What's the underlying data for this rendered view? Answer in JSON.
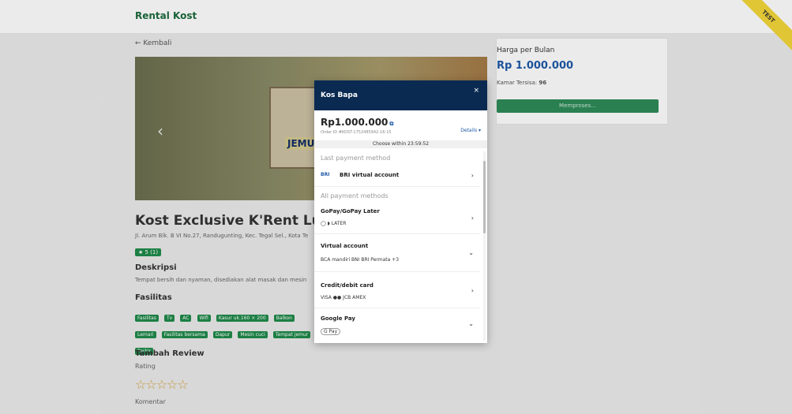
{
  "app": {
    "brand": "Rental Kost",
    "ribbon": "TEST"
  },
  "nav": {
    "back": "← Kembali"
  },
  "hero": {
    "poster_text": "JEMURAN PR",
    "prev_icon": "chevron-left"
  },
  "listing": {
    "title": "Kost Exclusive K'Rent Luxury T",
    "address": "Jl. Arum Blk. B VI No.27, Randugunting, Kec. Tegal Sel., Kota Te",
    "rating": "★ 5 (1)",
    "description_heading": "Deskripsi",
    "description": "Tempat bersih dan nyaman, disediakan alat masak dan mesin",
    "facilities_heading": "Fasilitas",
    "facilities": [
      "Fasilitas",
      "Tv",
      "AC",
      "Wifi",
      "Kasur uk.160 × 200",
      "Balkon",
      "Lemari",
      "Fasilitas bersama",
      "Dapur",
      "Mesin cuci",
      "Tempat jemur",
      "Parkir"
    ]
  },
  "review": {
    "heading": "Tambah Review",
    "rating_label": "Rating",
    "stars": "☆☆☆☆☆",
    "comment_label": "Komentar"
  },
  "price_card": {
    "label": "Harga per Bulan",
    "value": "Rp 1.000.000",
    "rooms_label": "Kamar Tersisa:",
    "rooms_value": "96",
    "button": "Memproses..."
  },
  "modal": {
    "title": "Kos Bapa",
    "close": "×",
    "amount": "Rp1.000.000",
    "order_id": "Order ID #KOST-1752485942-16-15",
    "details": "Details ▾",
    "timer": "Choose within 23:59:52",
    "last_heading": "Last payment method",
    "last_method": {
      "logo": "BRI",
      "name": "BRI virtual account"
    },
    "all_heading": "All payment methods",
    "methods": [
      {
        "name": "GoPay/GoPay Later",
        "logos": "◯  ◗  LATER",
        "chevron": "›"
      },
      {
        "name": "Virtual account",
        "logos": "BCA  mandiri  BNI  BRI  Permata  +3",
        "chevron": "⌄"
      },
      {
        "name": "Credit/debit card",
        "logos": "VISA  ●●  JCB  AMEX",
        "chevron": "›"
      },
      {
        "name": "Google Pay",
        "logos": "G Pay",
        "chevron": "⌄"
      }
    ]
  }
}
